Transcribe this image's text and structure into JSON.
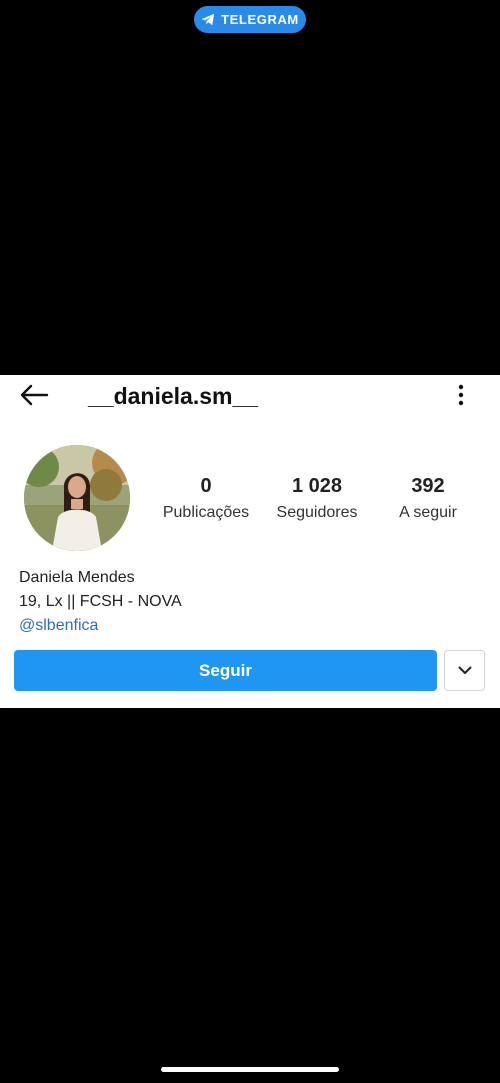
{
  "telegram_badge": {
    "label": "TELEGRAM",
    "icon": "telegram-plane-icon",
    "color": "#2a8ae8"
  },
  "header": {
    "back_icon": "back-arrow-icon",
    "username": "__daniela.sm__",
    "menu_icon": "more-vertical-icon"
  },
  "stats": {
    "posts": {
      "value": "0",
      "label": "Publicações"
    },
    "followers": {
      "value": "1 028",
      "label": "Seguidores"
    },
    "following": {
      "value": "392",
      "label": "A seguir"
    }
  },
  "bio": {
    "name": "Daniela Mendes",
    "line": "19, Lx || FCSH - NOVA",
    "mention": "@slbenfica"
  },
  "actions": {
    "follow_label": "Seguir",
    "dropdown_icon": "chevron-down-icon",
    "accent_color": "#1f96f1"
  }
}
